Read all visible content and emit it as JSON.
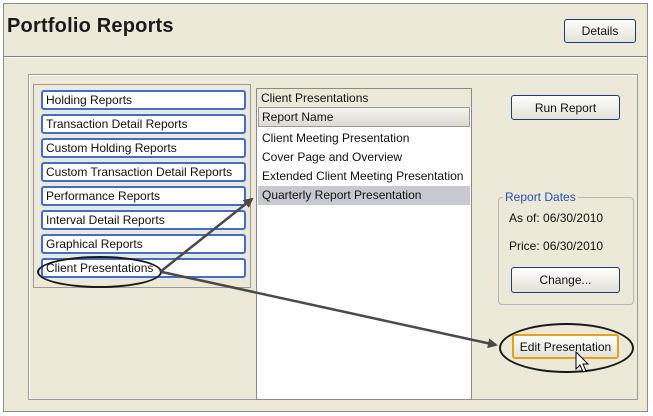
{
  "header": {
    "title": "Portfolio Reports",
    "details_label": "Details"
  },
  "categories": [
    "Holding Reports",
    "Transaction Detail Reports",
    "Custom Holding Reports",
    "Custom Transaction Detail Reports",
    "Performance Reports",
    "Interval Detail Reports",
    "Graphical Reports",
    "Client Presentations"
  ],
  "reports": {
    "caption": "Client Presentations",
    "column_header": "Report Name",
    "rows": [
      "Client Meeting Presentation",
      "Cover Page and Overview",
      "Extended Client Meeting Presentation",
      "Quarterly Report Presentation"
    ],
    "selected_index": 3
  },
  "actions": {
    "run_report": "Run Report",
    "change": "Change...",
    "edit_presentation": "Edit Presentation"
  },
  "report_dates": {
    "legend": "Report Dates",
    "as_of_label": "As of:",
    "as_of_value": "06/30/2010",
    "price_label": "Price:",
    "price_value": "06/30/2010"
  },
  "colors": {
    "item_border": "#3f6ecf",
    "selected_row": "#c8c8d0",
    "edit_button_border": "#e5a11b",
    "legend_text": "#2a4fb0"
  },
  "icons": [
    "mouse-pointer-icon"
  ]
}
